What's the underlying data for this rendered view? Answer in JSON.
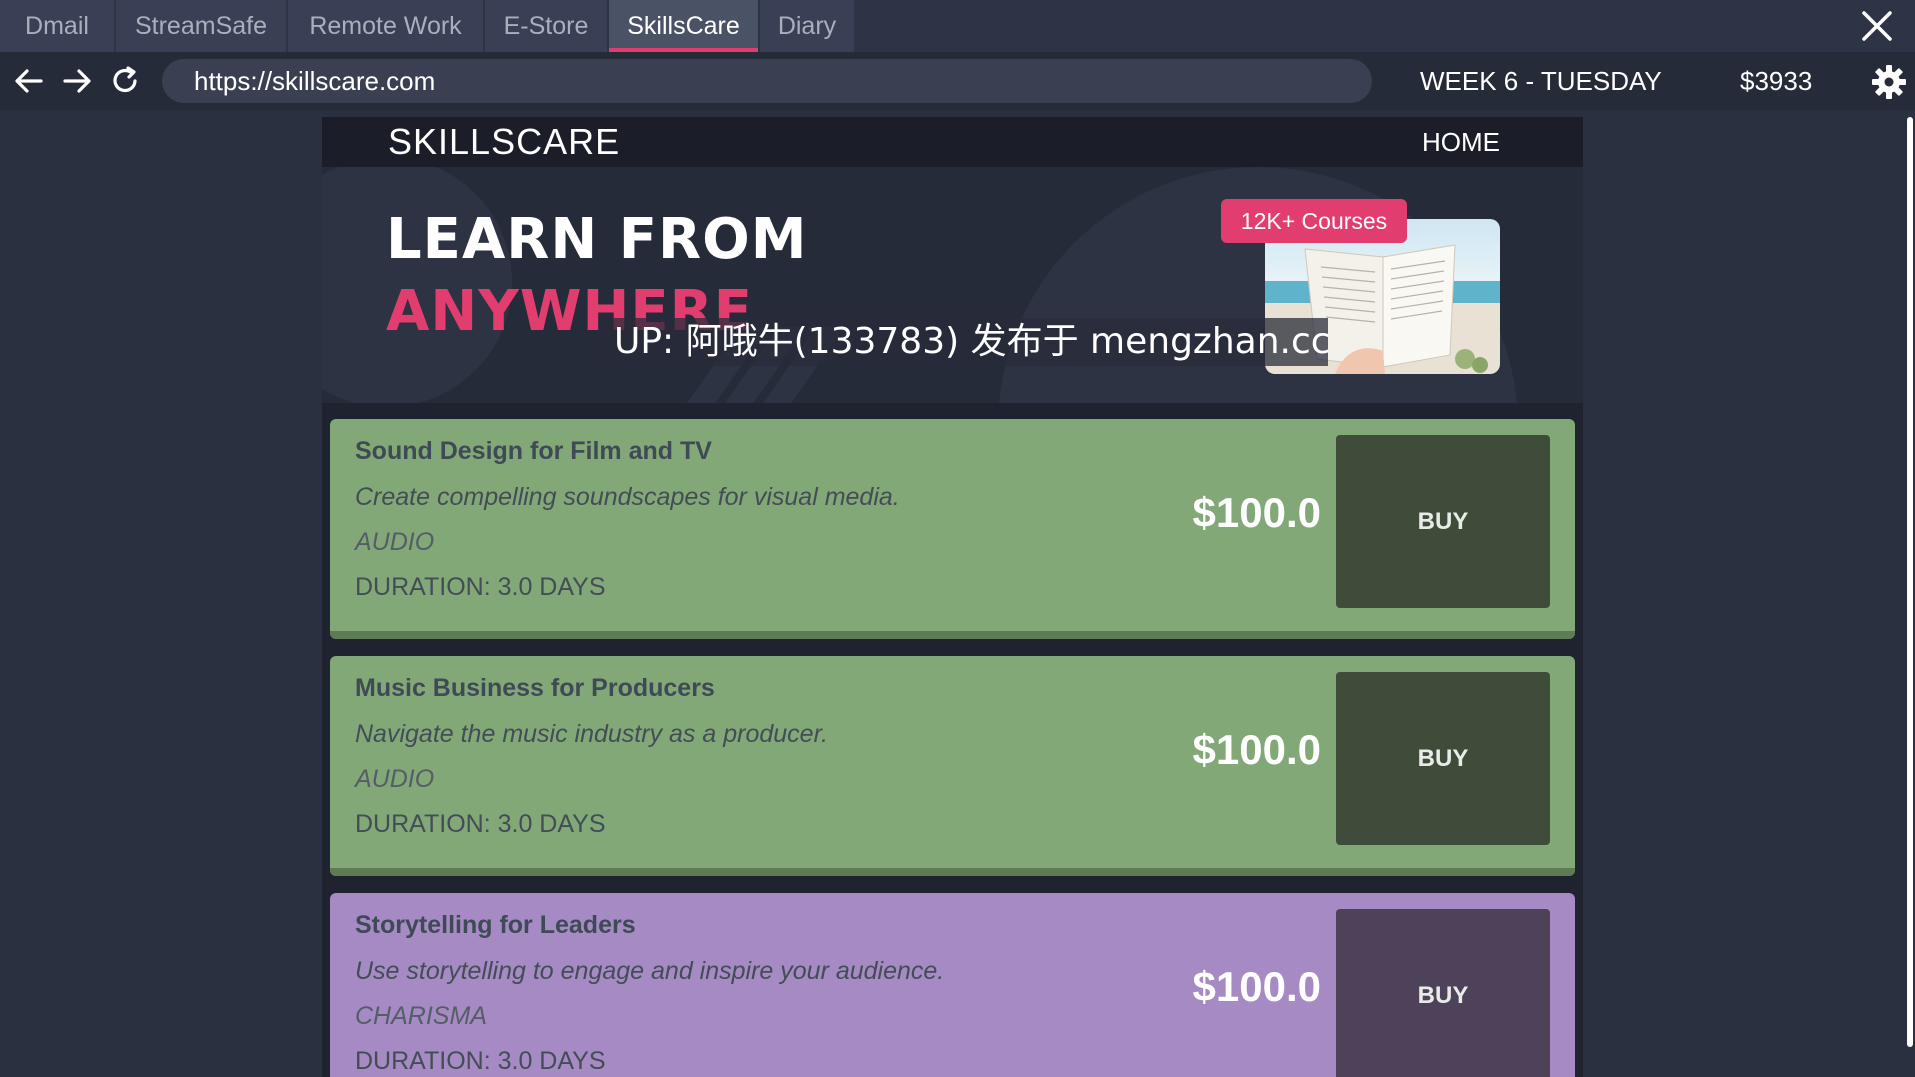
{
  "browser": {
    "tabs": [
      {
        "label": "Dmail",
        "active": false
      },
      {
        "label": "StreamSafe",
        "active": false
      },
      {
        "label": "Remote Work",
        "active": false
      },
      {
        "label": "E-Store",
        "active": false
      },
      {
        "label": "SkillsCare",
        "active": true
      },
      {
        "label": "Diary",
        "active": false
      }
    ],
    "url": "https://skillscare.com",
    "week_label": "WEEK 6 - TUESDAY",
    "balance": "$3933",
    "icons": [
      "back-icon",
      "forward-icon",
      "reload-icon",
      "gear-icon",
      "close-icon"
    ]
  },
  "site": {
    "logo": "SKILLSCARE",
    "nav_home": "HOME",
    "hero": {
      "line1": "LEARN FROM",
      "line2": "ANYWHERE",
      "badge": "12K+ Courses"
    }
  },
  "courses": [
    {
      "title": "Sound Design for Film and TV",
      "description": "Create compelling soundscapes for visual media.",
      "category": "AUDIO",
      "duration": "DURATION: 3.0 DAYS",
      "price": "$100.0",
      "buy_label": "BUY",
      "color": "#82a877"
    },
    {
      "title": "Music Business for Producers",
      "description": "Navigate the music industry as a producer.",
      "category": "AUDIO",
      "duration": "DURATION: 3.0 DAYS",
      "price": "$100.0",
      "buy_label": "BUY",
      "color": "#82a877"
    },
    {
      "title": "Storytelling for Leaders",
      "description": "Use storytelling to engage and inspire your audience.",
      "category": "CHARISMA",
      "duration": "DURATION: 3.0 DAYS",
      "price": "$100.0",
      "buy_label": "BUY",
      "color": "#a58ac3"
    }
  ],
  "overlay_text": "UP: 阿哦牛(133783) 发布于 mengzhan.cc",
  "colors": {
    "accent": "#e23d6f",
    "page_bg": "#1f2330",
    "chrome_bg": "#2d3446"
  }
}
